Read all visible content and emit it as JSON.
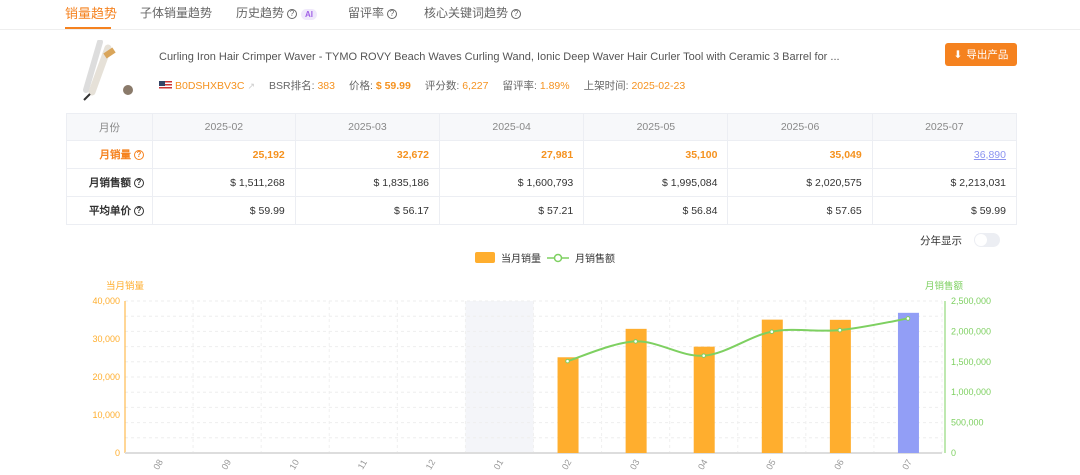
{
  "tabs": [
    "销量趋势",
    "子体销量趋势",
    "历史趋势",
    "留评率",
    "核心关键词趋势"
  ],
  "ai_badge": "AI",
  "product": {
    "title": "Curling Iron Hair Crimper Waver - TYMO ROVY Beach Waves Curling Wand, Ionic Deep Waver Hair Curler Tool with Ceramic 3 Barrel for ...",
    "asin": "B0DSHXBV3C",
    "bsr_label": "BSR排名:",
    "bsr": "383",
    "price_label": "价格:",
    "price": "$ 59.99",
    "ratings_label": "评分数:",
    "ratings": "6,227",
    "review_rate_label": "留评率:",
    "review_rate": "1.89%",
    "listed_label": "上架时间:",
    "listed": "2025-02-23"
  },
  "export_label": "导出产品",
  "table": {
    "header": "月份",
    "months": [
      "2025-02",
      "2025-03",
      "2025-04",
      "2025-05",
      "2025-06",
      "2025-07"
    ],
    "rows": [
      {
        "label": "月销量",
        "values": [
          "25,192",
          "32,672",
          "27,981",
          "35,100",
          "35,049",
          "36,890"
        ]
      },
      {
        "label": "月销售额",
        "values": [
          "$ 1,511,268",
          "$ 1,835,186",
          "$ 1,600,793",
          "$ 1,995,084",
          "$ 2,020,575",
          "$ 2,213,031"
        ]
      },
      {
        "label": "平均单价",
        "values": [
          "$ 59.99",
          "$ 56.17",
          "$ 57.21",
          "$ 56.84",
          "$ 57.65",
          "$ 59.99"
        ]
      }
    ]
  },
  "toggle_label": "分年显示",
  "colors": {
    "accent": "#f5821f",
    "bar": "#ffae2e",
    "bar_current": "#929ef6",
    "line": "#7ed061"
  },
  "chart_data": {
    "type": "bar+line",
    "legend": [
      "当月销量",
      "月销售额"
    ],
    "legend_position": "top-center",
    "left_axis_title": "当月销量",
    "right_axis_title": "月销售额",
    "categories": [
      "08",
      "09",
      "10",
      "11",
      "12",
      "01",
      "02",
      "03",
      "04",
      "05",
      "06",
      "07"
    ],
    "left_ylim": [
      0,
      40000
    ],
    "left_ticks": [
      "0",
      "10,000",
      "20,000",
      "30,000",
      "40,000"
    ],
    "right_ylim": [
      0,
      2500000
    ],
    "right_ticks": [
      "0",
      "500,000",
      "1,000,000",
      "1,500,000",
      "2,000,000",
      "2,500,000"
    ],
    "series": [
      {
        "name": "当月销量",
        "type": "bar",
        "values": [
          null,
          null,
          null,
          null,
          null,
          null,
          25192,
          32672,
          27981,
          35100,
          35049,
          36890
        ]
      },
      {
        "name": "月销售额",
        "type": "line",
        "values": [
          null,
          null,
          null,
          null,
          null,
          null,
          1511268,
          1835186,
          1600793,
          1995084,
          2020575,
          2213031
        ]
      }
    ],
    "highlight_category": "01"
  }
}
